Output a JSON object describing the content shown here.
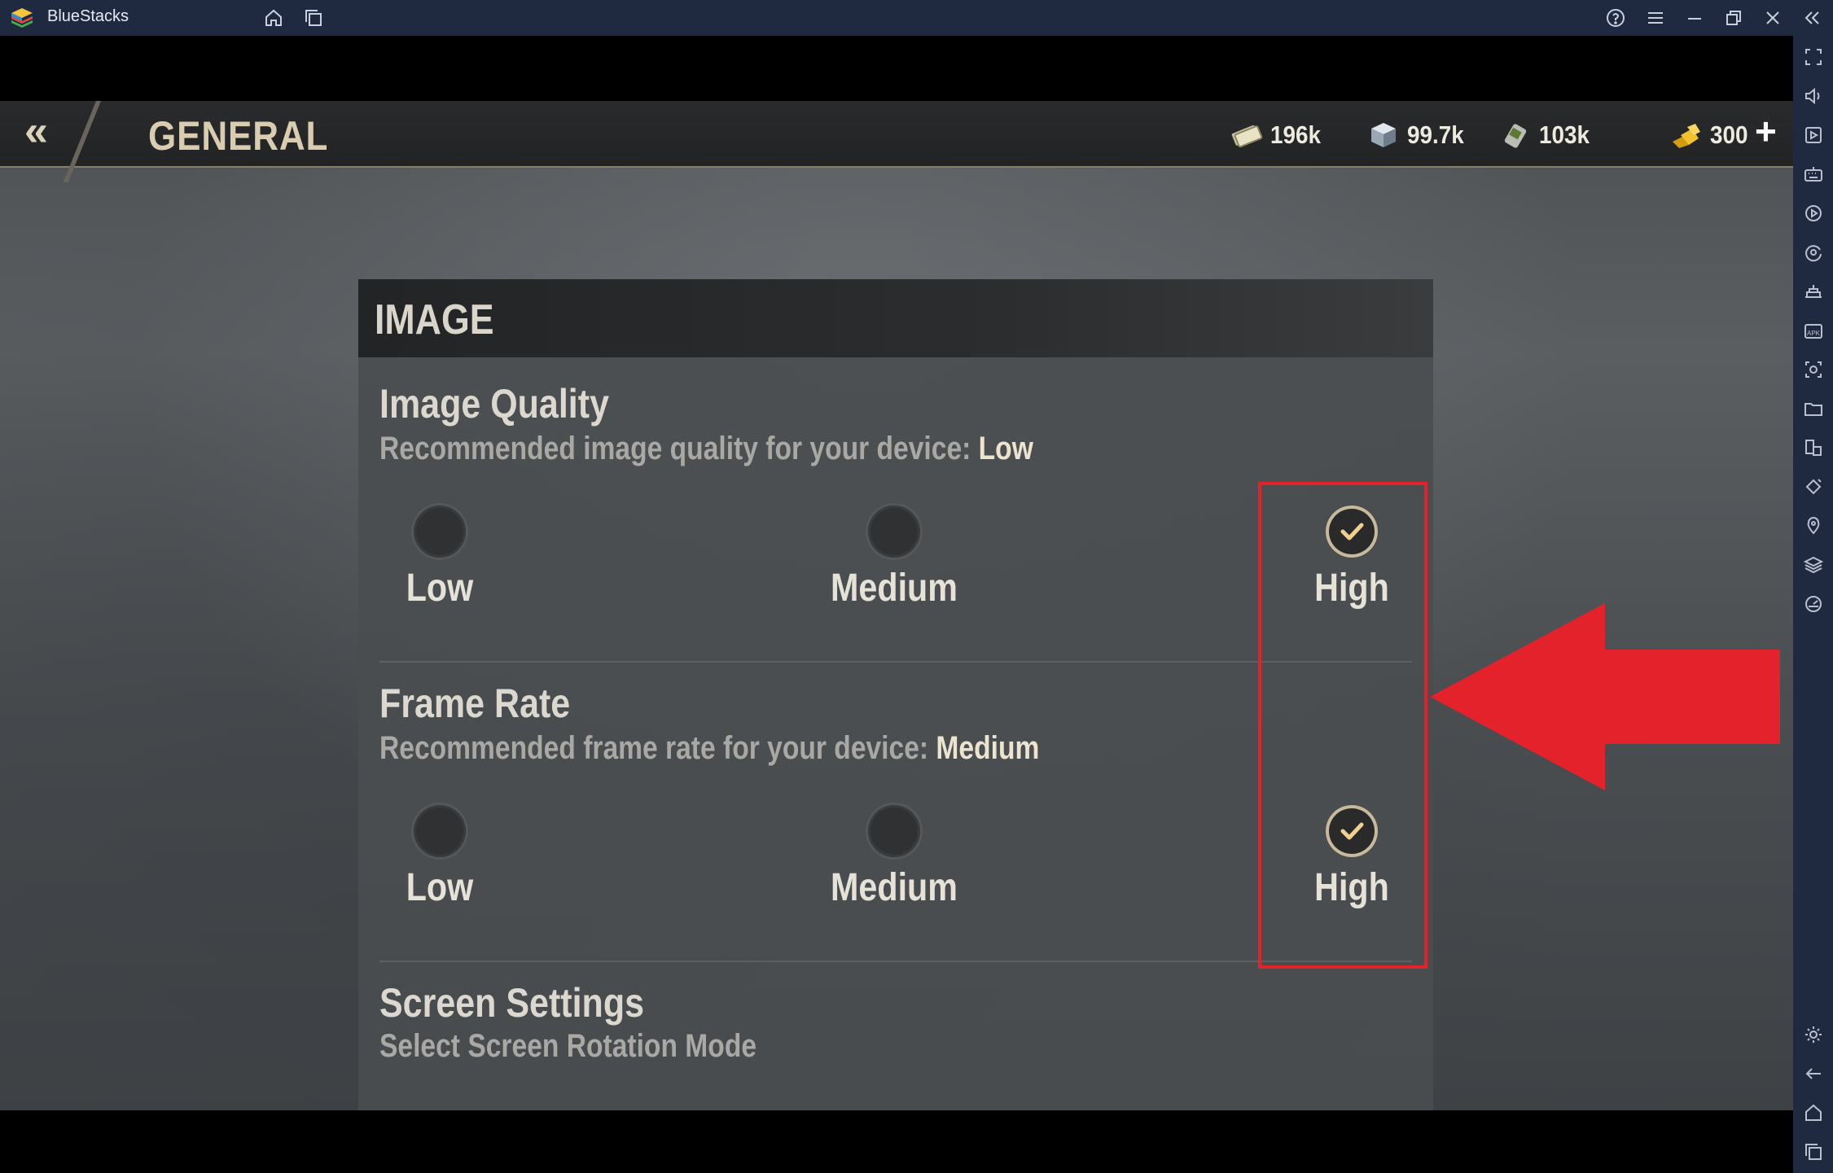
{
  "app": {
    "name": "BlueStacks",
    "brand_color": "#1f2940",
    "titlebar_icons": [
      "home-icon",
      "multi-instance-icon",
      "help-icon",
      "menu-icon",
      "minimize-icon",
      "restore-icon",
      "close-icon",
      "collapse-sidebar-icon"
    ],
    "sidebar_icons": [
      "fullscreen-icon",
      "volume-icon",
      "media-icon",
      "keyboard-controls-icon",
      "macro-record-icon",
      "sync-icon",
      "game-controls-icon",
      "apk-install-icon",
      "screenshot-icon",
      "folder-icon",
      "multi-window-icon",
      "rotate-icon",
      "location-icon",
      "layers-icon",
      "performance-icon",
      "settings-icon",
      "back-icon",
      "home-icon",
      "recent-apps-icon"
    ]
  },
  "game": {
    "header": {
      "back_label": "«",
      "title": "GENERAL",
      "resources": [
        {
          "icon": "cash-icon",
          "value": "196k"
        },
        {
          "icon": "steel-icon",
          "value": "99.7k"
        },
        {
          "icon": "oil-icon",
          "value": "103k"
        },
        {
          "icon": "gold-icon",
          "value": "300"
        }
      ],
      "plus_label": "+"
    },
    "panel": {
      "title": "IMAGE",
      "image_quality": {
        "title": "Image Quality",
        "desc_prefix": "Recommended image quality for your device: ",
        "desc_value": "Low",
        "options": [
          {
            "label": "Low",
            "selected": false
          },
          {
            "label": "Medium",
            "selected": false
          },
          {
            "label": "High",
            "selected": true
          }
        ]
      },
      "frame_rate": {
        "title": "Frame Rate",
        "desc_prefix": "Recommended frame rate for your device: ",
        "desc_value": "Medium",
        "options": [
          {
            "label": "Low",
            "selected": false
          },
          {
            "label": "Medium",
            "selected": false
          },
          {
            "label": "High",
            "selected": true
          }
        ]
      },
      "screen_settings": {
        "title": "Screen Settings",
        "desc": "Select Screen Rotation Mode"
      }
    },
    "annotation_color": "#e4222b"
  }
}
